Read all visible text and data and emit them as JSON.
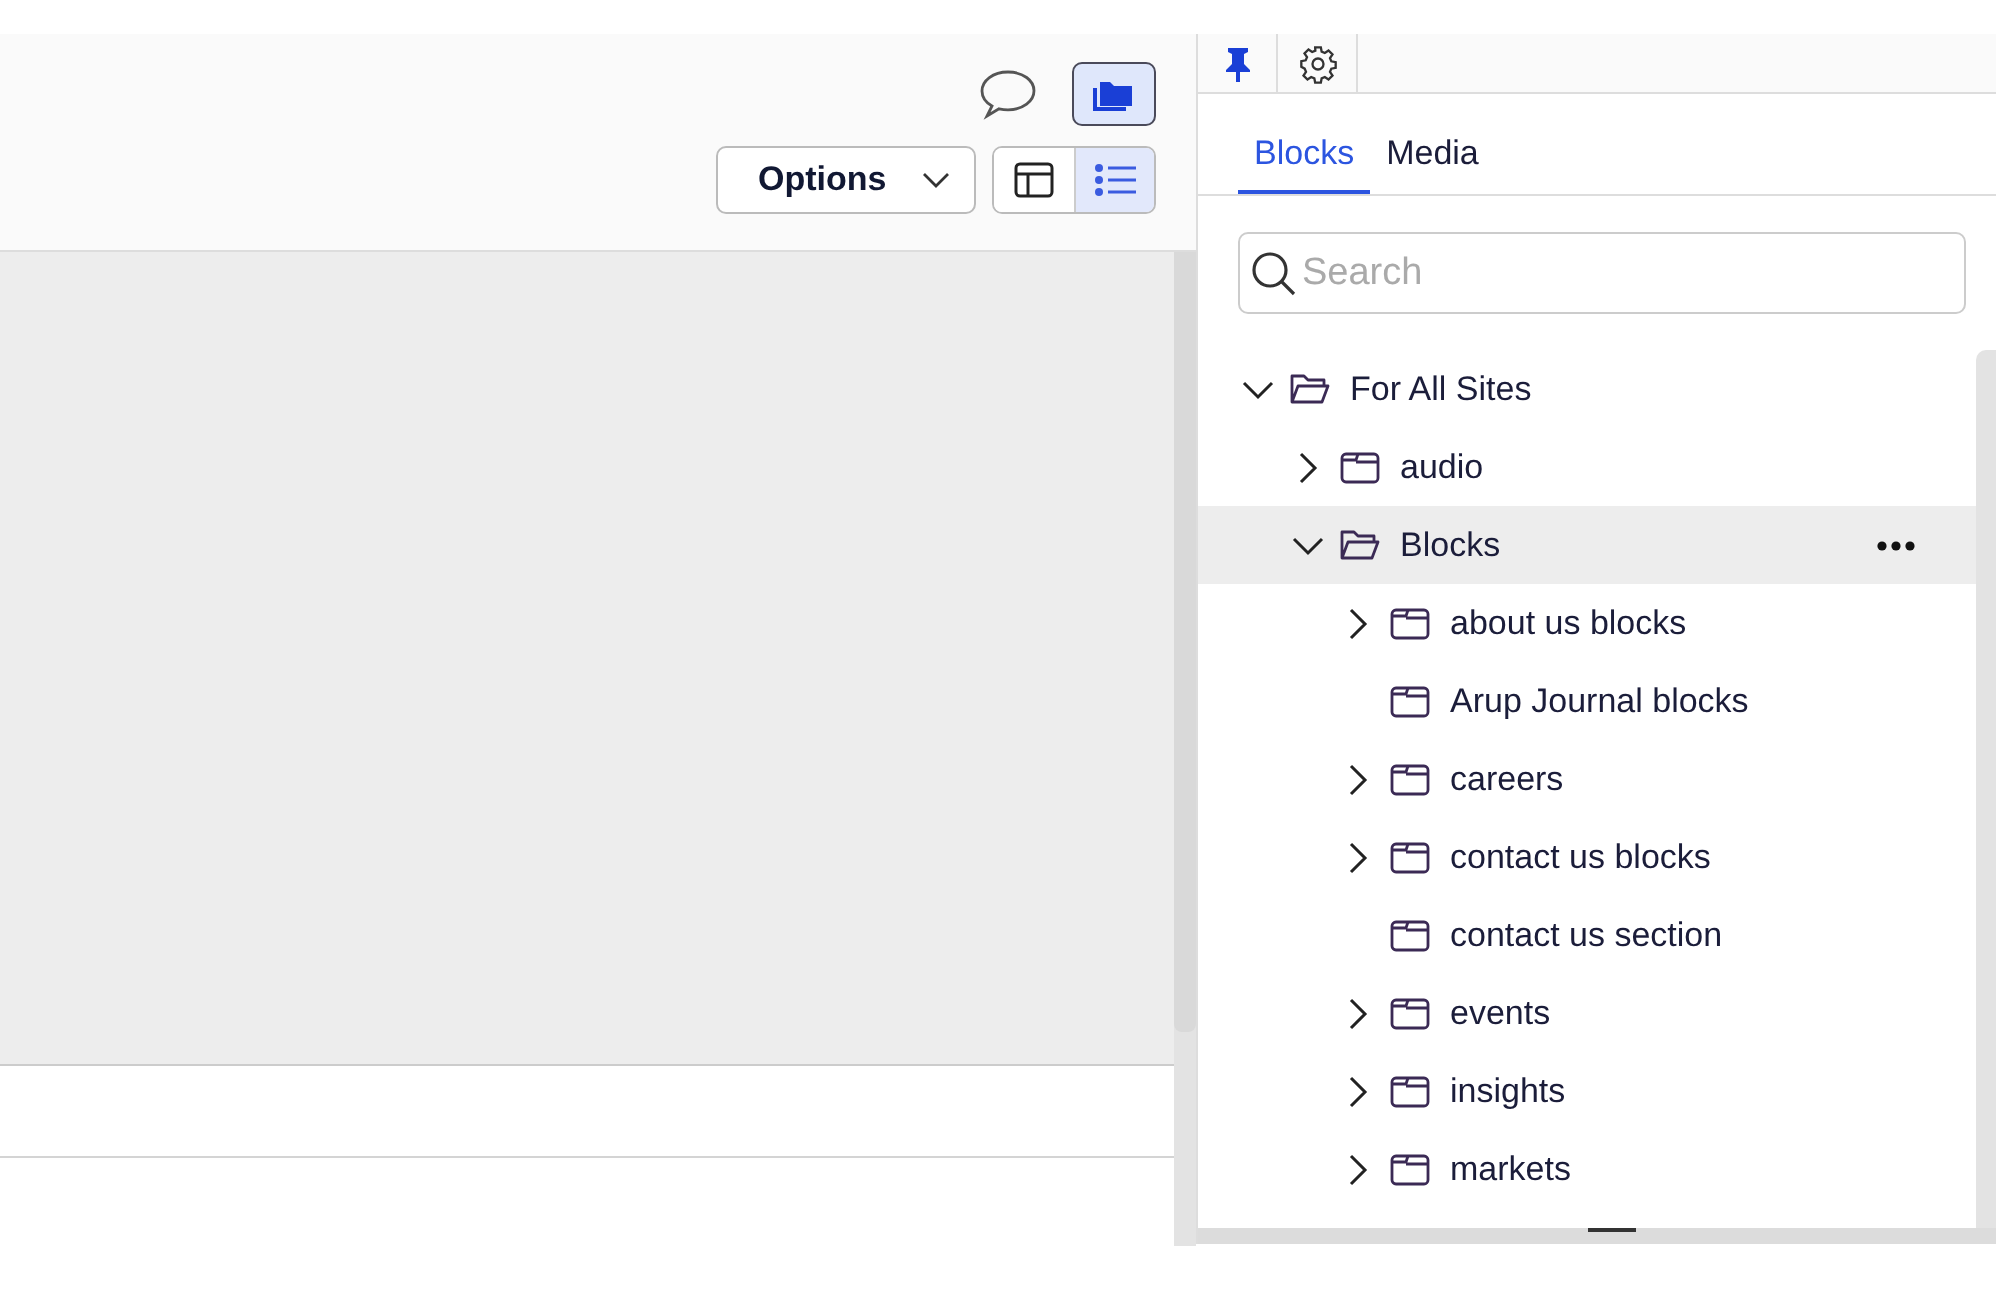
{
  "toolbar": {
    "comment_button": {
      "kind": "comment"
    },
    "folder_button": {
      "selected": true
    },
    "options_button": {
      "label": "Options"
    },
    "view_toggle": [
      {
        "kind": "layout",
        "selected": false
      },
      {
        "kind": "list",
        "selected": true
      }
    ]
  },
  "panel": {
    "pin": {
      "pinned": true
    },
    "tabs": [
      {
        "label": "Blocks",
        "selected": true
      },
      {
        "label": "Media",
        "selected": false
      }
    ],
    "search": {
      "placeholder": "Search"
    },
    "tree": [
      {
        "label": "For All Sites",
        "expandable": true,
        "expanded": true,
        "selected": false,
        "children": [
          {
            "label": "audio",
            "expandable": true,
            "expanded": false,
            "selected": false
          },
          {
            "label": "Blocks",
            "expandable": true,
            "expanded": true,
            "selected": true,
            "children": [
              {
                "label": "about us blocks",
                "expandable": true,
                "expanded": false,
                "selected": false
              },
              {
                "label": "Arup Journal blocks",
                "expandable": false,
                "selected": false
              },
              {
                "label": "careers",
                "expandable": true,
                "expanded": false,
                "selected": false
              },
              {
                "label": "contact us blocks",
                "expandable": true,
                "expanded": false,
                "selected": false
              },
              {
                "label": "contact us section",
                "expandable": false,
                "selected": false
              },
              {
                "label": "events",
                "expandable": true,
                "expanded": false,
                "selected": false
              },
              {
                "label": "insights",
                "expandable": true,
                "expanded": false,
                "selected": false
              },
              {
                "label": "markets",
                "expandable": true,
                "expanded": false,
                "selected": false
              }
            ]
          }
        ]
      }
    ]
  }
}
